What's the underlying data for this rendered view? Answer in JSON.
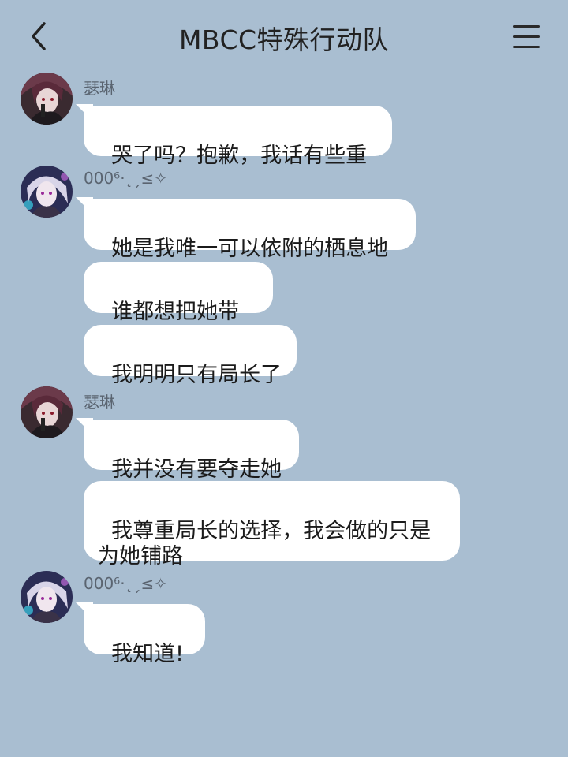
{
  "header": {
    "title": "MBCC特殊行动队",
    "back_icon": "chevron-left-icon",
    "menu_icon": "hamburger-menu-icon"
  },
  "messages": [
    {
      "sender": "瑟琳",
      "avatar": "avatar-selin",
      "bubbles": [
        "哭了吗？抱歉，我话有些重"
      ]
    },
    {
      "sender": "000⁶·˛ˏ≤✧",
      "avatar": "avatar-000",
      "bubbles": [
        "她是我唯一可以依附的栖息地",
        "谁都想把她带走",
        "我明明只有局长了"
      ]
    },
    {
      "sender": "瑟琳",
      "avatar": "avatar-selin",
      "bubbles": [
        "我并没有要夺走她",
        "我尊重局长的选择，我会做的只是为她铺路"
      ]
    },
    {
      "sender": "000⁶·˛ˏ≤✧",
      "avatar": "avatar-000",
      "bubbles": [
        "我知道!"
      ]
    }
  ],
  "colors": {
    "background": "#a9bed1",
    "bubble": "#ffffff",
    "sender": "#5a6470"
  }
}
